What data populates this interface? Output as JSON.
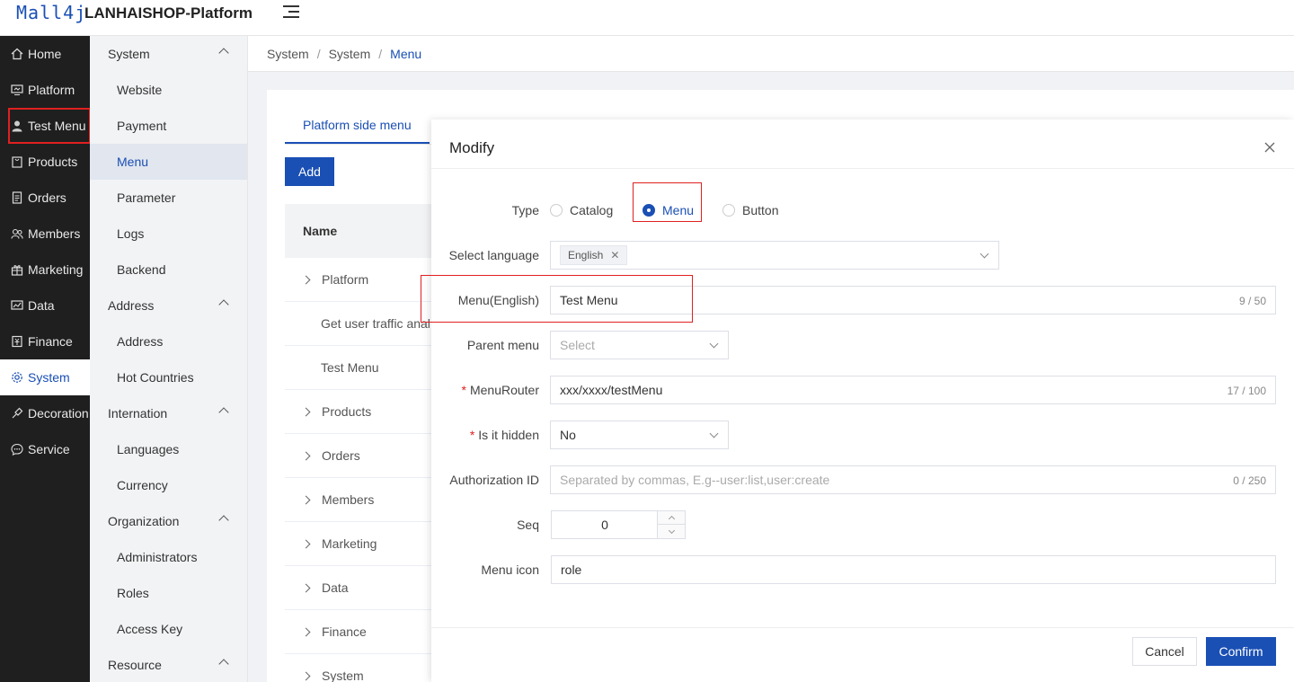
{
  "header": {
    "logo": "Mall4j",
    "title": "LANHAISHOP-Platform"
  },
  "sidebar": {
    "items": [
      {
        "label": "Home",
        "icon": "home-icon"
      },
      {
        "label": "Platform",
        "icon": "monitor-icon"
      },
      {
        "label": "Test Menu",
        "icon": "user-role-icon"
      },
      {
        "label": "Products",
        "icon": "bag-icon"
      },
      {
        "label": "Orders",
        "icon": "document-icon"
      },
      {
        "label": "Members",
        "icon": "users-icon"
      },
      {
        "label": "Marketing",
        "icon": "gift-icon"
      },
      {
        "label": "Data",
        "icon": "chart-icon"
      },
      {
        "label": "Finance",
        "icon": "finance-icon"
      },
      {
        "label": "System",
        "icon": "gear-icon"
      },
      {
        "label": "Decoration",
        "icon": "brush-icon"
      },
      {
        "label": "Service",
        "icon": "chat-icon"
      }
    ]
  },
  "submenu": {
    "system": {
      "label": "System",
      "items": [
        "Website",
        "Payment",
        "Menu",
        "Parameter",
        "Logs",
        "Backend"
      ]
    },
    "address": {
      "label": "Address",
      "items": [
        "Address",
        "Hot Countries"
      ]
    },
    "internation": {
      "label": "Internation",
      "items": [
        "Languages",
        "Currency"
      ]
    },
    "organization": {
      "label": "Organization",
      "items": [
        "Administrators",
        "Roles",
        "Access Key"
      ]
    },
    "resource": {
      "label": "Resource"
    }
  },
  "breadcrumb": [
    "System",
    "System",
    "Menu"
  ],
  "main": {
    "tab": "Platform side menu",
    "add_label": "Add",
    "table_header": "Name",
    "rows": [
      "Platform",
      "Get user traffic anal",
      "Test Menu",
      "Products",
      "Orders",
      "Members",
      "Marketing",
      "Data",
      "Finance",
      "System"
    ]
  },
  "dialog": {
    "title": "Modify",
    "type": {
      "label": "Type",
      "options": [
        "Catalog",
        "Menu",
        "Button"
      ],
      "selected": "Menu"
    },
    "language": {
      "label": "Select language",
      "tag": "English"
    },
    "menu_name": {
      "label": "Menu(English)",
      "value": "Test Menu",
      "count": "9 / 50"
    },
    "parent": {
      "label": "Parent menu",
      "placeholder": "Select"
    },
    "router": {
      "label": "MenuRouter",
      "value": "xxx/xxxx/testMenu",
      "count": "17 / 100"
    },
    "hidden": {
      "label": "Is it hidden",
      "value": "No"
    },
    "auth": {
      "label": "Authorization ID",
      "placeholder": "Separated by commas, E.g--user:list,user:create",
      "count": "0 / 250"
    },
    "seq": {
      "label": "Seq",
      "value": "0"
    },
    "icon": {
      "label": "Menu icon",
      "value": "role"
    },
    "cancel": "Cancel",
    "confirm": "Confirm"
  },
  "colors": {
    "brand": "#1a4fb4",
    "highlight": "#e02020",
    "sidebar_bg": "#1f1f1f"
  }
}
